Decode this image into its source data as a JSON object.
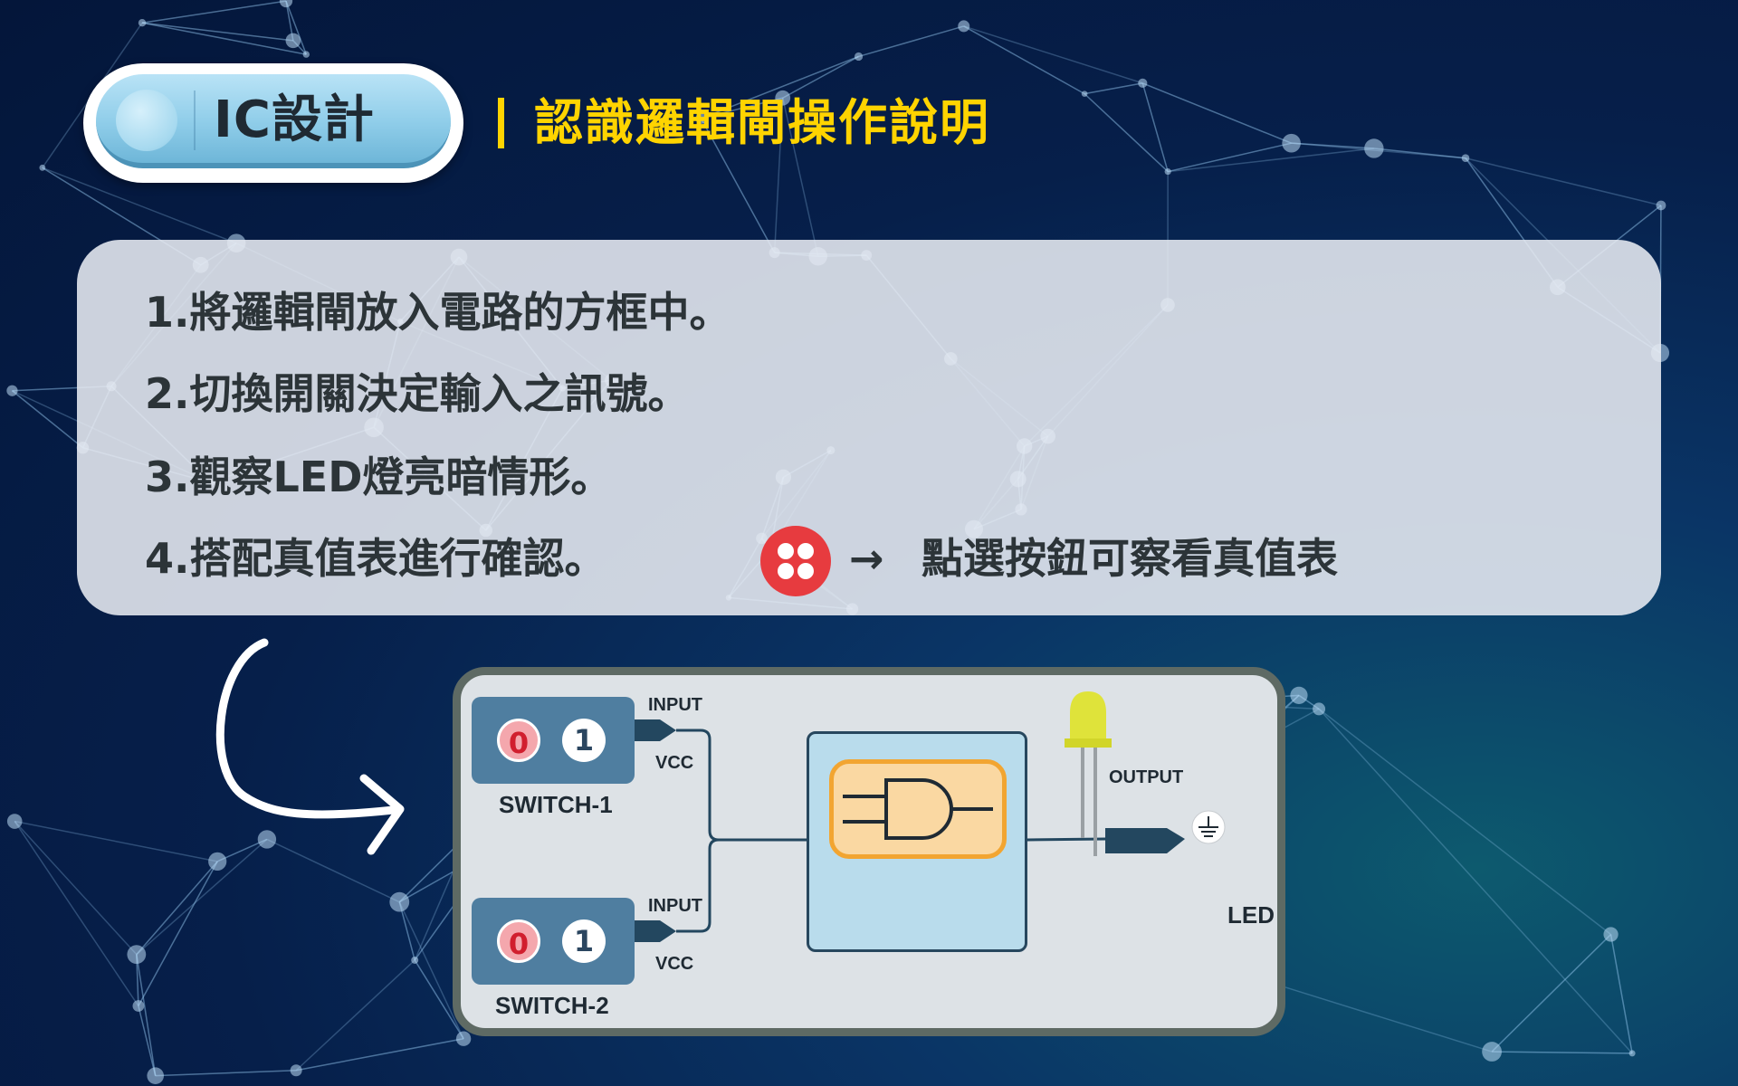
{
  "header": {
    "pill_title": "IC設計",
    "subtitle": "認識邏輯閘操作說明"
  },
  "instructions": {
    "steps": [
      "1.將邏輯閘放入電路的方框中。",
      "2.切換開關決定輸入之訊號。",
      "3.觀察LED燈亮暗情形。",
      "4.搭配真值表進行確認。"
    ],
    "hint_arrow": "→",
    "hint_text": "點選按鈕可察看真值表",
    "truth_table_button_color": "#e73b3f"
  },
  "circuit": {
    "switches": [
      {
        "name": "SWITCH-1",
        "off_label": "0",
        "on_label": "1"
      },
      {
        "name": "SWITCH-2",
        "off_label": "0",
        "on_label": "1"
      }
    ],
    "input_label": "INPUT",
    "vcc_label": "VCC",
    "output_label": "OUTPUT",
    "led_label": "LED",
    "gate_type_icon": "and-gate-icon",
    "led_color": "#dfe33a"
  },
  "colors": {
    "subtitle": "#ffd400",
    "panel_bg": "#e8ecf2",
    "text_dark": "#2c3438",
    "circuit_border": "#5e6a64",
    "switch_bg": "#4f7ea0",
    "gate_box_bg": "#b9dcec",
    "gate_chip_bg": "#fad8a2",
    "gate_chip_border": "#f2a531"
  }
}
